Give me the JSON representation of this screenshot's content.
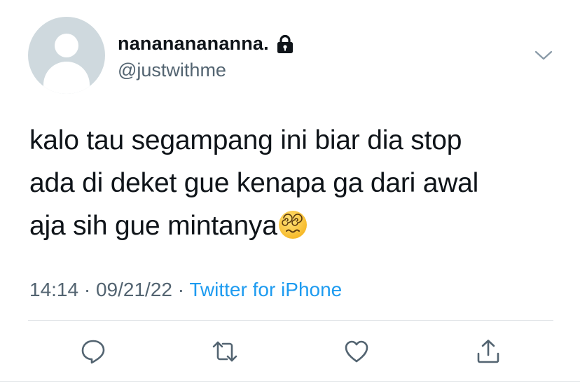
{
  "author": {
    "display_name": "nanananananna.",
    "handle": "@justwithme",
    "protected_icon": "lock-icon",
    "avatar": "default-avatar-silhouette"
  },
  "tweet": {
    "text_lines": [
      "kalo tau segampang ini biar dia stop",
      "ada di deket gue kenapa ga dari awal",
      "aja sih gue mintanya"
    ],
    "emoji": "face-with-spiral-eyes",
    "time": "14:14",
    "date": "09/21/22",
    "separator": "·",
    "source": "Twitter for iPhone"
  },
  "actions": [
    {
      "name": "reply",
      "icon": "reply-icon"
    },
    {
      "name": "retweet",
      "icon": "retweet-icon"
    },
    {
      "name": "like",
      "icon": "heart-icon"
    },
    {
      "name": "share",
      "icon": "share-icon"
    }
  ],
  "colors": {
    "text": "#0f1419",
    "secondary": "#536471",
    "accent": "#1d9bf0",
    "avatar_bg": "#cfd9de",
    "divider": "#dfe3e6"
  }
}
